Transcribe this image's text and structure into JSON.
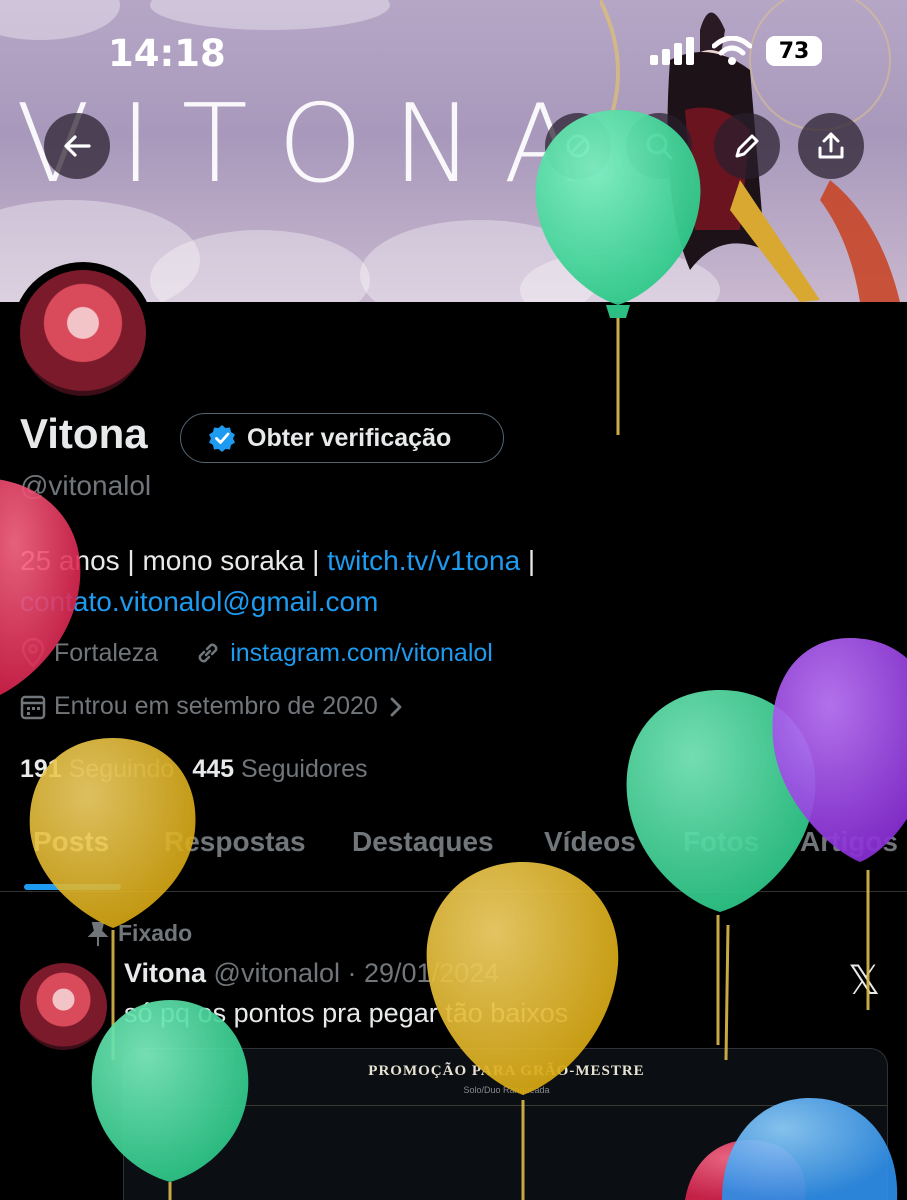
{
  "status_bar": {
    "time": "14:18",
    "battery": "73"
  },
  "banner": {
    "word": "VITONA"
  },
  "profile": {
    "name": "Vitona",
    "verify_label": "Obter verificação",
    "handle": "@vitonalol",
    "bio_text": "25 anos | mono soraka | ",
    "bio_link": "twitch.tv/v1tona",
    "bio_sep": " |",
    "bio_email": "contato.vitonalol@gmail.com",
    "location": "Fortaleza",
    "website": "instagram.com/vitonalol",
    "joined": "Entrou em setembro de 2020",
    "following_count": "191",
    "following_label": "Seguindo",
    "followers_count": "445",
    "followers_label": "Seguidores"
  },
  "tabs": [
    {
      "label": "Posts",
      "active": true
    },
    {
      "label": "Respostas"
    },
    {
      "label": "Destaques"
    },
    {
      "label": "Vídeos"
    },
    {
      "label": "Fotos"
    },
    {
      "label": "Artigos"
    }
  ],
  "post": {
    "pinned_label": "Fixado",
    "author": "Vitona",
    "meta": "@vitonalol · 29/01/2024",
    "text": "só pq os pontos pra pegar tão baixos",
    "media_title": "PROMOÇÃO PARA GRÃO-MESTRE",
    "media_subtitle": "Solo/Duo Ranqueada"
  },
  "colors": {
    "accent": "#1d9bf0",
    "background": "#000000",
    "muted": "#71767b"
  },
  "icons": [
    "back-arrow-icon",
    "fire-icon",
    "search-icon",
    "edit-icon",
    "share-icon",
    "verified-badge-icon",
    "location-icon",
    "link-icon",
    "calendar-icon",
    "chevron-right-icon",
    "pin-icon",
    "x-logo-icon"
  ]
}
